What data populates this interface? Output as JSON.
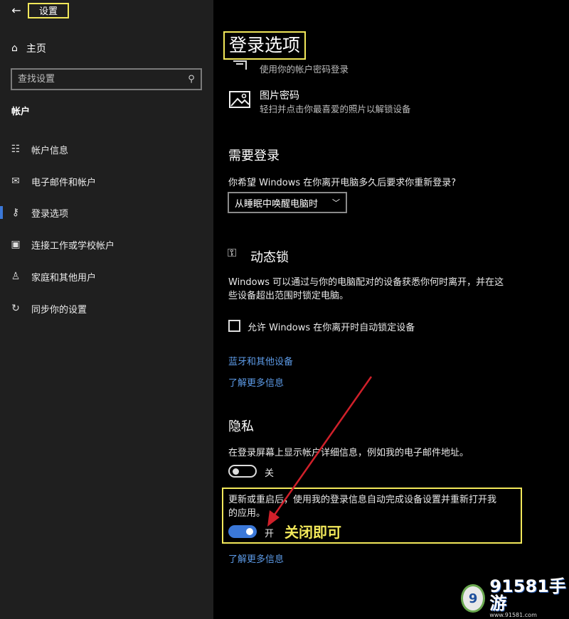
{
  "sidebar": {
    "back_icon": "back-arrow-icon",
    "window_title": "设置",
    "home_label": "主页",
    "search_placeholder": "查找设置",
    "section_label": "帐户",
    "items": [
      {
        "label": "帐户信息",
        "icon": "person-card-icon"
      },
      {
        "label": "电子邮件和帐户",
        "icon": "mail-icon"
      },
      {
        "label": "登录选项",
        "icon": "key-icon",
        "active": true
      },
      {
        "label": "连接工作或学校帐户",
        "icon": "briefcase-icon"
      },
      {
        "label": "家庭和其他用户",
        "icon": "person-add-icon"
      },
      {
        "label": "同步你的设置",
        "icon": "sync-icon"
      }
    ]
  },
  "main": {
    "page_title": "登录选项",
    "password_desc": "使用你的帐户密码登录",
    "picture_password": {
      "title": "图片密码",
      "desc": "轻扫并点击你最喜爱的照片以解锁设备"
    },
    "require_signin": {
      "heading": "需要登录",
      "question": "你希望 Windows 在你离开电脑多久后要求你重新登录?",
      "dropdown_value": "从睡眠中唤醒电脑时"
    },
    "dynamic_lock": {
      "heading": "动态锁",
      "desc_line1": "Windows 可以通过与你的电脑配对的设备获悉你何时离开，并在这",
      "desc_line2": "些设备超出范围时锁定电脑。",
      "checkbox_label": "允许 Windows 在你离开时自动锁定设备",
      "checked": false,
      "link_bluetooth": "蓝牙和其他设备",
      "link_learn_more": "了解更多信息"
    },
    "privacy": {
      "heading": "隐私",
      "account_details_desc": "在登录屏幕上显示帐户详细信息，例如我的电子邮件地址。",
      "toggle1_state": "关",
      "toggle1_on": false,
      "autofinish_line1": "更新或重启后，使用我的登录信息自动完成设备设置并重新打开我",
      "autofinish_line2": "的应用。",
      "toggle2_state": "开",
      "toggle2_on": true,
      "annotation": "关闭即可",
      "link_learn_more": "了解更多信息"
    }
  },
  "watermark": {
    "logo_text": "9",
    "brand": "91581手游",
    "url": "www.91581.com"
  },
  "colors": {
    "highlight_yellow": "#f2e85a",
    "accent_blue": "#3b78d8",
    "link_blue": "#5c9ae6",
    "arrow_red": "#d0202a"
  }
}
